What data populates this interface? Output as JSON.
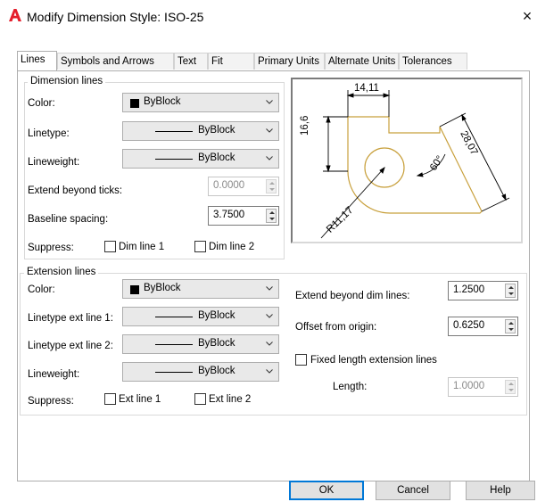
{
  "window": {
    "title": "Modify Dimension Style: ISO-25",
    "app_icon": "autocad-a-icon",
    "close_glyph": "×",
    "brand_color": "#e41d2b"
  },
  "tabs": [
    {
      "label": "Lines",
      "active": true
    },
    {
      "label": "Symbols and Arrows"
    },
    {
      "label": "Text"
    },
    {
      "label": "Fit"
    },
    {
      "label": "Primary Units"
    },
    {
      "label": "Alternate Units"
    },
    {
      "label": "Tolerances"
    }
  ],
  "dimension_lines": {
    "legend": "Dimension lines",
    "color_label": "Color:",
    "color_value": "ByBlock",
    "linetype_label": "Linetype:",
    "linetype_value": "ByBlock",
    "lineweight_label": "Lineweight:",
    "lineweight_value": "ByBlock",
    "extend_ticks_label": "Extend beyond ticks:",
    "extend_ticks_value": "0.0000",
    "baseline_label": "Baseline spacing:",
    "baseline_value": "3.7500",
    "suppress_label": "Suppress:",
    "dim_line_1": "Dim line 1",
    "dim_line_2": "Dim line 2"
  },
  "extension_lines": {
    "legend": "Extension lines",
    "color_label": "Color:",
    "color_value": "ByBlock",
    "linetype1_label": "Linetype ext line 1:",
    "linetype1_value": "ByBlock",
    "linetype2_label": "Linetype ext line 2:",
    "linetype2_value": "ByBlock",
    "lineweight_label": "Lineweight:",
    "lineweight_value": "ByBlock",
    "suppress_label": "Suppress:",
    "ext_line_1": "Ext line 1",
    "ext_line_2": "Ext line 2",
    "extend_dim_label": "Extend beyond dim lines:",
    "extend_dim_value": "1.2500",
    "offset_label": "Offset from origin:",
    "offset_value": "0.6250",
    "fixed_length_label": "Fixed length extension lines",
    "length_label": "Length:",
    "length_value": "1.0000"
  },
  "preview": {
    "dim_top": "14,11",
    "dim_left": "16,6",
    "dim_right": "28,07",
    "dim_angle": "60°",
    "dim_radius": "R11,17",
    "part_color": "#c8a03c"
  },
  "buttons": {
    "ok": "OK",
    "cancel": "Cancel",
    "help": "Help"
  }
}
